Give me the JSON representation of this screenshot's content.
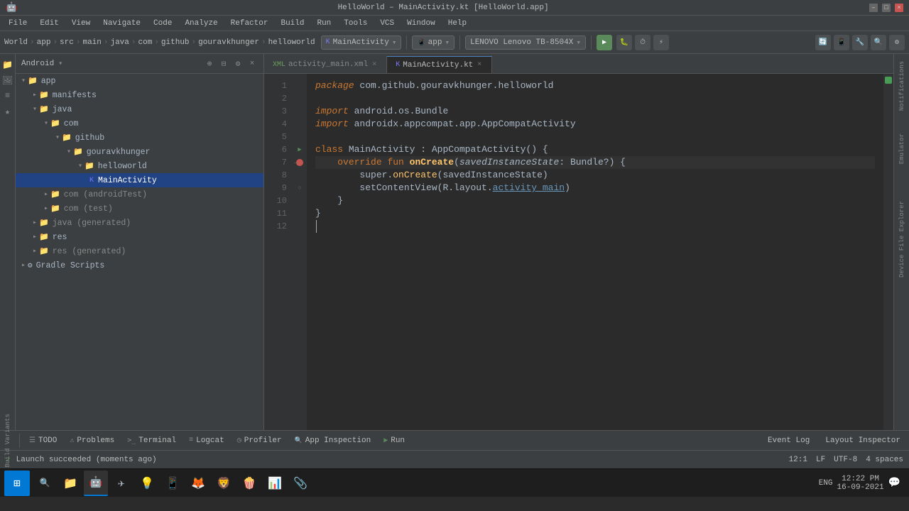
{
  "titlebar": {
    "title": "HelloWorld – MainActivity.kt [HelloWorld.app]",
    "controls": [
      "–",
      "□",
      "×"
    ]
  },
  "menubar": {
    "items": [
      "File",
      "Edit",
      "View",
      "Navigate",
      "Code",
      "Analyze",
      "Refactor",
      "Build",
      "Run",
      "Tools",
      "VCS",
      "Window",
      "Help"
    ]
  },
  "toolbar": {
    "project_label": "HelloWorld",
    "breadcrumb": [
      "World",
      "app",
      "src",
      "main",
      "java",
      "com",
      "github",
      "gouravkhunger",
      "helloworld"
    ],
    "main_activity": "MainActivity",
    "device_label": "LENOVO Lenovo TB-8504X",
    "app_config": "app"
  },
  "project_panel": {
    "title": "Android",
    "items": [
      {
        "label": "app",
        "type": "folder",
        "level": 0,
        "expanded": true
      },
      {
        "label": "manifests",
        "type": "folder",
        "level": 1,
        "expanded": false
      },
      {
        "label": "java",
        "type": "folder",
        "level": 1,
        "expanded": true
      },
      {
        "label": "com",
        "type": "folder",
        "level": 2,
        "expanded": true
      },
      {
        "label": "github",
        "type": "folder",
        "level": 3,
        "expanded": true
      },
      {
        "label": "gouravkhunger",
        "type": "folder",
        "level": 4,
        "expanded": true
      },
      {
        "label": "helloworld",
        "type": "folder",
        "level": 5,
        "expanded": true
      },
      {
        "label": "MainActivity",
        "type": "kotlin",
        "level": 6,
        "selected": true
      },
      {
        "label": "com (androidTest)",
        "type": "folder",
        "level": 2,
        "expanded": false,
        "gray": true
      },
      {
        "label": "com (test)",
        "type": "folder",
        "level": 2,
        "expanded": false,
        "gray": true
      },
      {
        "label": "java (generated)",
        "type": "folder",
        "level": 1,
        "expanded": false,
        "gray": true
      },
      {
        "label": "res",
        "type": "folder",
        "level": 1,
        "expanded": false
      },
      {
        "label": "res (generated)",
        "type": "folder",
        "level": 1,
        "expanded": false,
        "gray": true
      },
      {
        "label": "Gradle Scripts",
        "type": "folder",
        "level": 0,
        "expanded": false
      }
    ]
  },
  "tabs": [
    {
      "label": "activity_main.xml",
      "type": "xml",
      "active": false
    },
    {
      "label": "MainActivity.kt",
      "type": "kotlin",
      "active": true
    }
  ],
  "code": {
    "lines": [
      {
        "num": 1,
        "content": "package com.github.gouravkhunger.helloworld"
      },
      {
        "num": 2,
        "content": ""
      },
      {
        "num": 3,
        "content": "import android.os.Bundle"
      },
      {
        "num": 4,
        "content": "import androidx.appcompat.app.AppCompatActivity"
      },
      {
        "num": 5,
        "content": ""
      },
      {
        "num": 6,
        "content": "class MainActivity : AppCompatActivity() {"
      },
      {
        "num": 7,
        "content": "    override fun onCreate(savedInstanceState: Bundle?) {"
      },
      {
        "num": 8,
        "content": "        super.onCreate(savedInstanceState)"
      },
      {
        "num": 9,
        "content": "        setContentView(R.layout.activity_main)"
      },
      {
        "num": 10,
        "content": "    }"
      },
      {
        "num": 11,
        "content": "}"
      },
      {
        "num": 12,
        "content": ""
      }
    ]
  },
  "bottom_tabs": [
    {
      "label": "TODO",
      "icon": "☰"
    },
    {
      "label": "Problems",
      "icon": "⚠"
    },
    {
      "label": "Terminal",
      "icon": ">_"
    },
    {
      "label": "Logcat",
      "icon": "≡"
    },
    {
      "label": "Profiler",
      "icon": "◷"
    },
    {
      "label": "App Inspection",
      "icon": "🔍"
    },
    {
      "label": "Run",
      "icon": "▶"
    }
  ],
  "status_bar": {
    "message": "Launch succeeded (moments ago)",
    "position": "12:1",
    "line_ending": "LF",
    "encoding": "UTF-8",
    "indent": "4 spaces"
  },
  "right_tools": [
    {
      "label": "Event Log"
    },
    {
      "label": "Layout Inspector"
    }
  ],
  "taskbar": {
    "time": "12:22 PM",
    "date": "16-09-2021",
    "lang": "ENG",
    "icons": [
      "⊞",
      "📁",
      "💬",
      "🦁",
      "💻",
      "📱",
      "🦊",
      "❤",
      "⬤",
      "📊",
      "📎"
    ]
  },
  "side_panels": {
    "left": [
      "Project",
      "Resource Manager",
      "Structure",
      "Favorites"
    ],
    "right": [
      "Notifications",
      "Emulator",
      "Device File Explorer"
    ],
    "bottom_left": [
      "Build Variants"
    ]
  }
}
